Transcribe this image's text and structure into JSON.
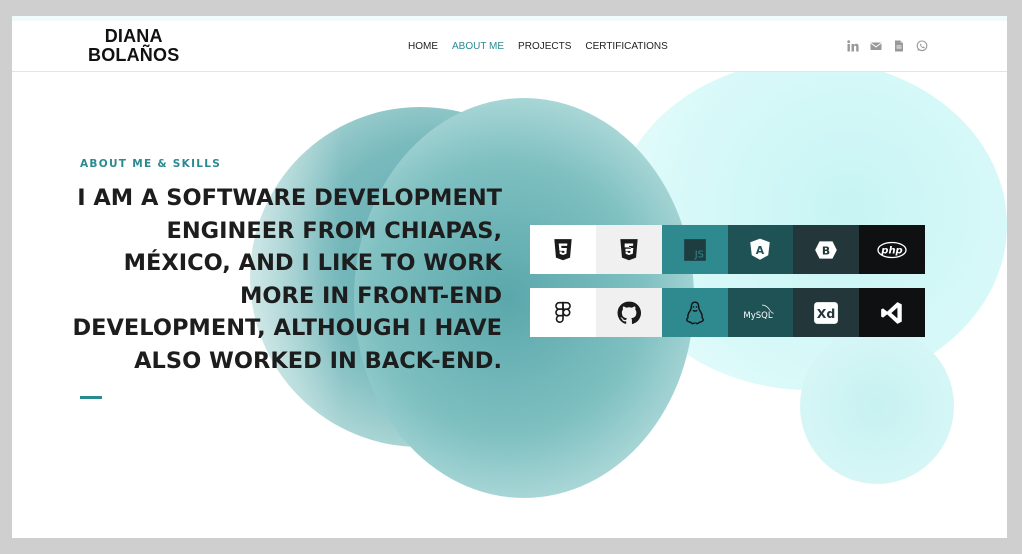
{
  "brand": {
    "line1": "DIANA",
    "line2": "BOLAÑOS"
  },
  "nav": {
    "items": [
      {
        "label": "HOME",
        "active": false
      },
      {
        "label": "ABOUT ME",
        "active": true
      },
      {
        "label": "PROJECTS",
        "active": false
      },
      {
        "label": "CERTIFICATIONS",
        "active": false
      }
    ]
  },
  "socials": [
    "linkedin-icon",
    "email-icon",
    "document-icon",
    "whatsapp-icon"
  ],
  "hero": {
    "eyebrow": "ABOUT ME & SKILLS",
    "headline": "I AM A SOFTWARE DEVELOPMENT ENGINEER FROM CHIAPAS, MÉXICO, AND I LIKE TO WORK MORE IN FRONT-END DEVELOPMENT, ALTHOUGH I HAVE ALSO WORKED IN BACK-END."
  },
  "skills": {
    "row1": [
      {
        "icon": "html5-icon",
        "bg": "#ffffff"
      },
      {
        "icon": "css3-icon",
        "bg": "#f0f0f0"
      },
      {
        "icon": "javascript-icon",
        "label": "JS",
        "bg": "#2f8a90"
      },
      {
        "icon": "angular-icon",
        "label": "A",
        "bg": "#1e5255"
      },
      {
        "icon": "bootstrap-icon",
        "label": "B",
        "bg": "#23363a"
      },
      {
        "icon": "php-icon",
        "label": "php",
        "bg": "#0e1012"
      }
    ],
    "row2": [
      {
        "icon": "figma-icon",
        "bg": "#ffffff"
      },
      {
        "icon": "github-icon",
        "bg": "#f0f0f0"
      },
      {
        "icon": "linux-icon",
        "bg": "#2f8a90"
      },
      {
        "icon": "mysql-icon",
        "label": "MySQL",
        "bg": "#1e5255"
      },
      {
        "icon": "adobe-xd-icon",
        "label": "Xd",
        "bg": "#23363a"
      },
      {
        "icon": "vscode-icon",
        "bg": "#0e1012"
      }
    ]
  },
  "colors": {
    "accent": "#2a8a90",
    "text": "#1d1d1d",
    "frame": "#cfcfcf"
  }
}
